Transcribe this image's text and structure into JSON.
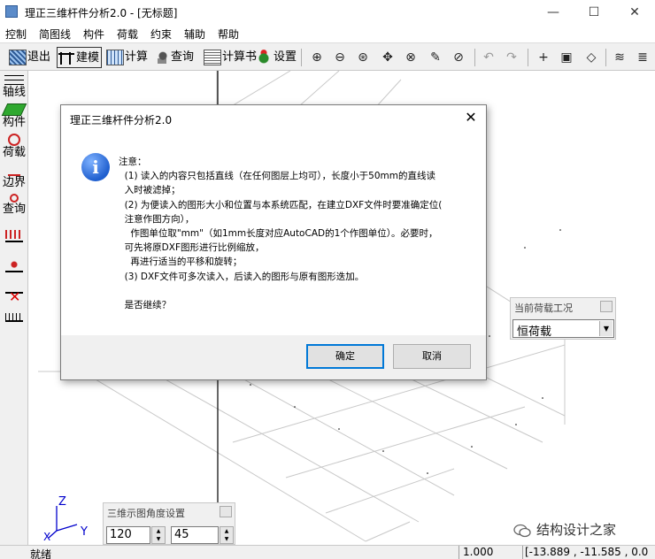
{
  "window": {
    "title": "理正三维杆件分析2.0 - [无标题]",
    "controls": {
      "minimize": "—",
      "maximize": "☐",
      "close": "✕"
    }
  },
  "menu": [
    "控制",
    "简图线",
    "构件",
    "荷载",
    "约束",
    "辅助",
    "帮助"
  ],
  "toolbar": {
    "buttons": [
      "退出",
      "建模",
      "计算",
      "查询",
      "计算书",
      "设置"
    ],
    "tools": [
      "zoom-in",
      "zoom-out",
      "zoom-window",
      "pan",
      "zoom-extents",
      "edit-view",
      "zoom-realtime",
      "undo",
      "redo",
      "point",
      "window-select",
      "view-3d",
      "layer-1",
      "layer-2"
    ]
  },
  "left_palette": {
    "items": [
      "轴线",
      "构件",
      "荷载",
      "边界",
      "查询"
    ],
    "tools": [
      "node-load-tool",
      "support-tool",
      "delete-tool",
      "member-load-tool"
    ]
  },
  "dialog": {
    "title": "理正三维杆件分析2.0",
    "lines": [
      "注意：",
      "  (1) 读入的内容只包括直线（在任何图层上均可），长度小于50mm的直线读",
      "  入时被滤掉；",
      "  (2) 为便读入的图形大小和位置与本系统匹配，在建立DXF文件时要准确定位(",
      "  注意作图方向），",
      "    作图单位取\"mm\"（如1mm长度对应AutoCAD的1个作图单位）。必要时，",
      "  可先将原DXF图形进行比例缩放，",
      "    再进行适当的平移和旋转；",
      "  (3) DXF文件可多次读入，后读入的图形与原有图形迭加。",
      "",
      "  是否继续？"
    ],
    "ok_label": "确定",
    "cancel_label": "取消"
  },
  "load_case_panel": {
    "title": "当前荷载工况",
    "selected": "恒荷载"
  },
  "angle_panel": {
    "title": "三维示图角度设置",
    "value1": "120",
    "value2": "45"
  },
  "axes": {
    "z": "Z",
    "y": "Y",
    "x": "X"
  },
  "statusbar": {
    "text": "就绪",
    "scale": "1.000",
    "coords": "[-13.889 , -11.585 , 0.0"
  },
  "watermark": "结构设计之家",
  "colors": {
    "dialog_accent": "#0078d7",
    "grid": "#c8c8c8"
  }
}
